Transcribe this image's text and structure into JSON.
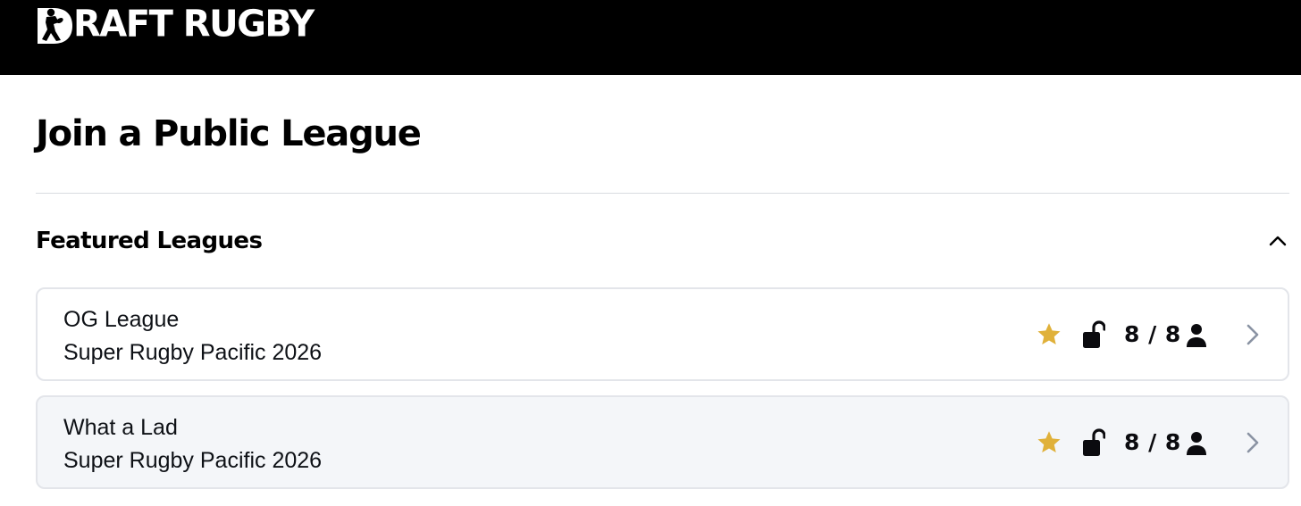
{
  "header": {
    "brand_name": "RAFT RUGBY",
    "brand_full": "DRAFT RUGBY",
    "logo_icon": "rugby-player-d-logo"
  },
  "page": {
    "title": "Join a Public League"
  },
  "featured": {
    "title": "Featured Leagues",
    "toggle_icon": "chevron-up-icon",
    "leagues": [
      {
        "name": "OG League",
        "competition": "Super Rugby Pacific 2026",
        "featured_icon": "star-icon",
        "access_icon": "unlocked-padlock-icon",
        "members": "8 / 8",
        "members_icon": "person-icon"
      },
      {
        "name": "What a Lad",
        "competition": "Super Rugby Pacific 2026",
        "featured_icon": "star-icon",
        "access_icon": "unlocked-padlock-icon",
        "members": "8 / 8",
        "members_icon": "person-icon"
      }
    ]
  },
  "colors": {
    "header_bg": "#000000",
    "star": "#e0b13a",
    "chevron": "#8a93a3",
    "card_border": "#e3e5ea",
    "card_alt_bg": "#f4f6f9"
  }
}
